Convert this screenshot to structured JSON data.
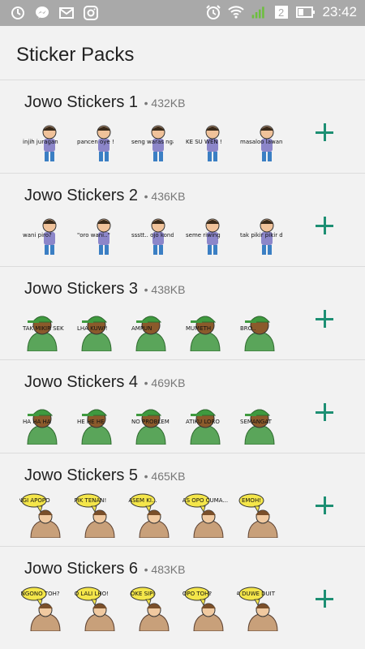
{
  "status_bar": {
    "time": "23:42",
    "left_icons": [
      "sync-icon",
      "messenger-icon",
      "mail-icon",
      "instagram-icon"
    ],
    "right_icons": [
      "alarm-icon",
      "wifi-icon",
      "signal-icon",
      "battery-icon"
    ]
  },
  "header": {
    "title": "Sticker Packs"
  },
  "colors": {
    "accent": "#1d8f73",
    "status_bar": "#a9a9a9",
    "background": "#f2f2f2"
  },
  "packs": [
    {
      "name": "Jowo Stickers 1",
      "size": "• 432KB",
      "stickers": [
        {
          "kind": "man",
          "caption": "injih juragan"
        },
        {
          "kind": "man",
          "caption": "pancen oye !"
        },
        {
          "kind": "man",
          "caption": "seng waras ngalah!"
        },
        {
          "kind": "man",
          "caption": "KE SU WEN !"
        },
        {
          "kind": "man",
          "caption": "masaloo lawan ..."
        }
      ]
    },
    {
      "name": "Jowo Stickers 2",
      "size": "• 436KB",
      "stickers": [
        {
          "kind": "man",
          "caption": "wani piro?"
        },
        {
          "kind": "man",
          "caption": "\"oro wani..\""
        },
        {
          "kind": "man",
          "caption": "ssstt.. ojo kondo sopo sopo"
        },
        {
          "kind": "man",
          "caption": "seme riwing"
        },
        {
          "kind": "man",
          "caption": "tak pikir pikir dhisek"
        }
      ]
    },
    {
      "name": "Jowo Stickers 3",
      "size": "• 438KB",
      "stickers": [
        {
          "kind": "cap",
          "caption": "TAK MIKIR SEK"
        },
        {
          "kind": "cap",
          "caption": "LHA KUWI!"
        },
        {
          "kind": "cap",
          "caption": "AMPUN"
        },
        {
          "kind": "cap",
          "caption": "MUMETH"
        },
        {
          "kind": "cap",
          "caption": "BRO.."
        }
      ]
    },
    {
      "name": "Jowo Stickers 4",
      "size": "• 469KB",
      "stickers": [
        {
          "kind": "cap",
          "caption": "HA HA HA"
        },
        {
          "kind": "cap",
          "caption": "HE HE HE"
        },
        {
          "kind": "cap",
          "caption": "NO PROBLEM"
        },
        {
          "kind": "cap",
          "caption": "ATIKU LORO"
        },
        {
          "kind": "cap",
          "caption": "SEMANGAT"
        }
      ]
    },
    {
      "name": "Jowo Stickers 5",
      "size": "• 465KB",
      "stickers": [
        {
          "kind": "elder",
          "caption": "NGI APOPO"
        },
        {
          "kind": "elder",
          "caption": "APIK TENAN!"
        },
        {
          "kind": "elder",
          "caption": "ASEM KI..."
        },
        {
          "kind": "elder",
          "caption": "ANGKAS OPO CUMA..."
        },
        {
          "kind": "elder",
          "caption": "EMOH!"
        }
      ]
    },
    {
      "name": "Jowo Stickers 6",
      "size": "• 483KB",
      "stickers": [
        {
          "kind": "elder",
          "caption": "OH, NGONO TOH?"
        },
        {
          "kind": "elder",
          "caption": "OJO LALI LHO!"
        },
        {
          "kind": "elder",
          "caption": "OKE SIP!"
        },
        {
          "kind": "elder",
          "caption": "OPO TOH?"
        },
        {
          "kind": "elder",
          "caption": "ORA DUWE DUIT"
        }
      ]
    }
  ]
}
